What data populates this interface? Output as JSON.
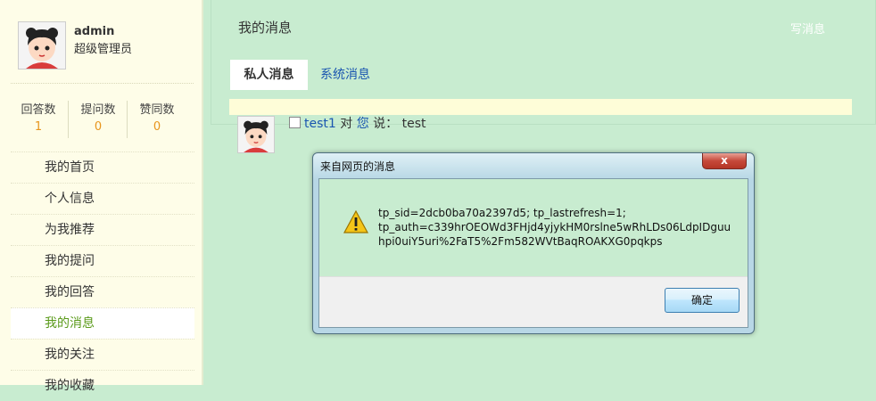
{
  "user": {
    "name": "admin",
    "role": "超级管理员"
  },
  "stats": [
    {
      "label": "回答数",
      "value": "1"
    },
    {
      "label": "提问数",
      "value": "0"
    },
    {
      "label": "赞同数",
      "value": "0"
    }
  ],
  "menu": [
    {
      "label": "我的首页"
    },
    {
      "label": "个人信息"
    },
    {
      "label": "为我推荐"
    },
    {
      "label": "我的提问"
    },
    {
      "label": "我的回答"
    },
    {
      "label": "我的消息"
    },
    {
      "label": "我的关注"
    },
    {
      "label": "我的收藏"
    }
  ],
  "active_menu": "我的消息",
  "main": {
    "title": "我的消息",
    "write_label": "写消息",
    "tabs": [
      {
        "label": "私人消息"
      },
      {
        "label": "系统消息"
      }
    ],
    "message": {
      "sender": "test1",
      "to_word": "对",
      "recipient": "您",
      "says": "说：",
      "text": "test"
    }
  },
  "dialog": {
    "title": "来自网页的消息",
    "close_label": "x",
    "lines": [
      "tp_sid=2dcb0ba70a2397d5; tp_lastrefresh=1;",
      "tp_auth=c339hrOEOWd3FHjd4yjykHM0rslne5wRhLDs06LdpIDguu",
      "hpi0uiY5uri%2FaT5%2Fm582WVtBaqROAKXG0pqkps"
    ],
    "ok_label": "确定"
  },
  "colors": {
    "accent_orange": "#e8951d",
    "active_green": "#5a9a1a",
    "link_blue": "#1a56b0",
    "bg_green": "#c8ecd0",
    "sidebar_bg": "#fefde8"
  },
  "icons": {
    "avatar": "cartoon-girl-avatar",
    "warning": "warning-triangle-icon"
  }
}
